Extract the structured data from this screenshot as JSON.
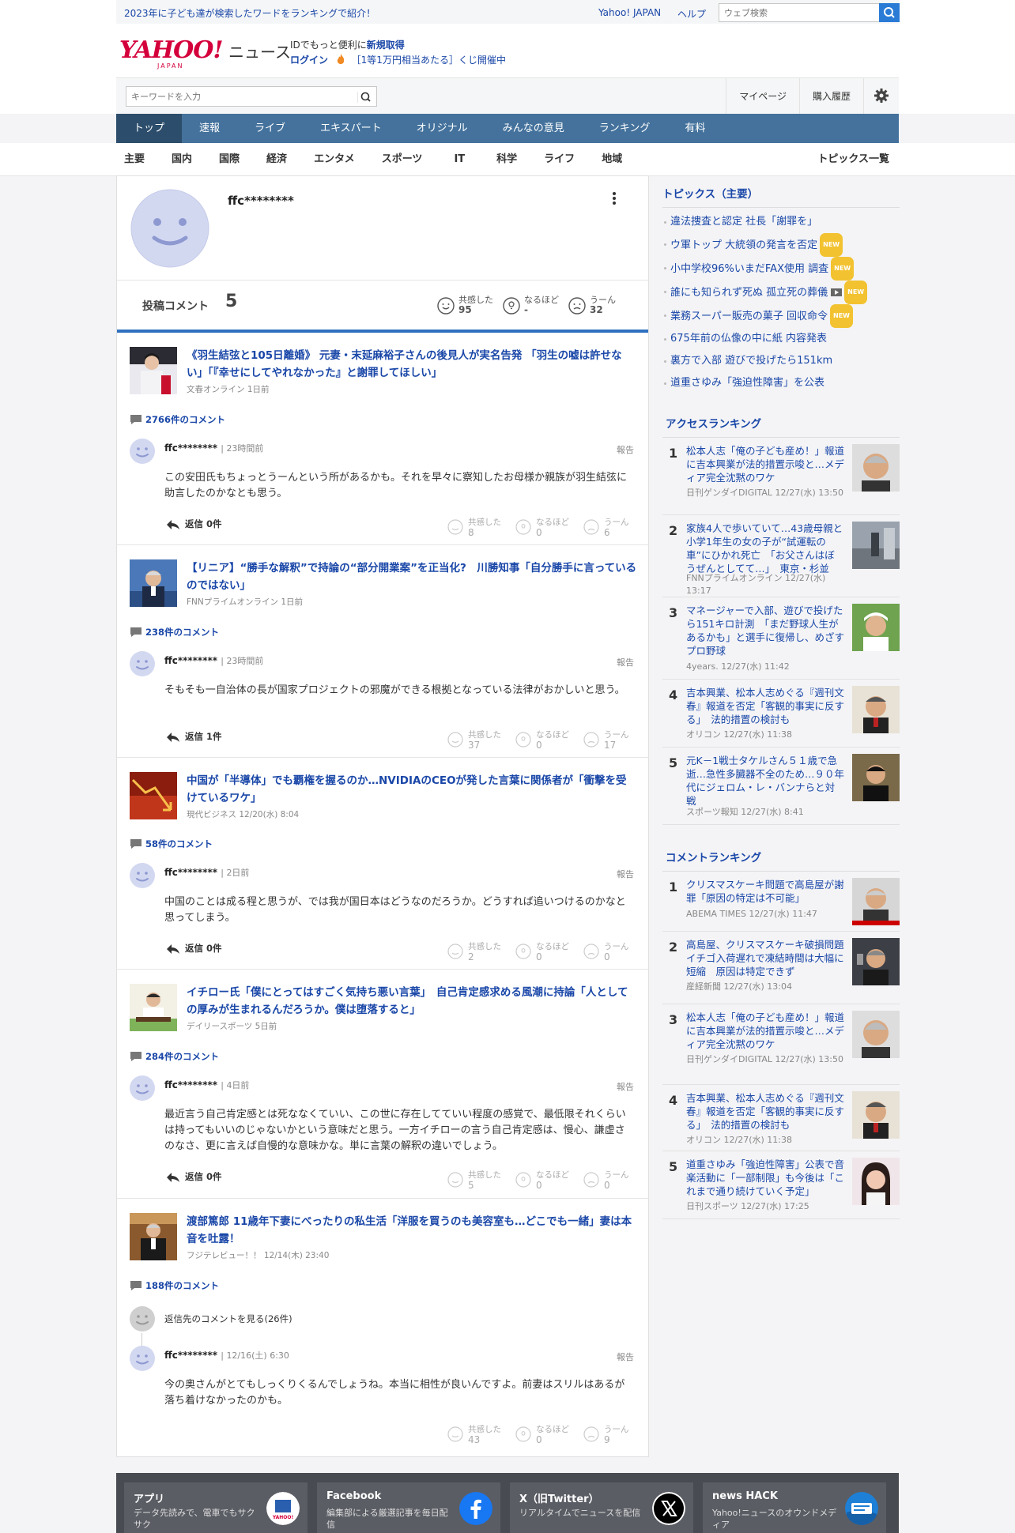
{
  "top": {
    "promo": "2023年に子ども達が検索したワードをランキングで紹介！",
    "yahoo_japan": "Yahoo! JAPAN",
    "help": "ヘルプ",
    "search_placeholder": "ウェブ検索"
  },
  "header": {
    "logo": "YAHOO!",
    "logo_sub": "JAPAN",
    "news": "ニュース",
    "line1_a": "IDでもっと便利に",
    "line1_b": "新規取得",
    "login": "ログイン",
    "lottery": "［1等1万円相当あたる］くじ開催中"
  },
  "searchbar": {
    "placeholder": "キーワードを入力",
    "mypage": "マイページ",
    "purchase": "購入履歴"
  },
  "mainnav": [
    "トップ",
    "速報",
    "ライブ",
    "エキスパート",
    "オリジナル",
    "みんなの意見",
    "ランキング",
    "有料"
  ],
  "subnav": [
    "主要",
    "国内",
    "国際",
    "経済",
    "エンタメ",
    "スポーツ",
    "IT",
    "科学",
    "ライフ",
    "地域"
  ],
  "subnav_topics": "トピックス一覧",
  "profile": {
    "name": "ffc********",
    "comments_label": "投稿コメント",
    "comments_count": "5",
    "reactions": [
      {
        "label": "共感した",
        "value": "95"
      },
      {
        "label": "なるほど",
        "value": "-"
      },
      {
        "label": "うーん",
        "value": "32"
      }
    ]
  },
  "items": [
    {
      "title": "《羽生結弦と105日離婚》 元妻・末延麻裕子さんの後見人が実名告発 「羽生の嘘は許せない」「『幸せにしてやれなかった』と謝罪してほしい」",
      "source": "文春オンライン 1日前",
      "comment_count": "2766件のコメント",
      "user": "ffc********",
      "time": "23時間前",
      "report": "報告",
      "text": "この安田氏もちょっとうーんという所があるかも。それを早々に察知したお母様か親族が羽生結弦に助言したのかなとも思う。",
      "reply": "返信 0件",
      "r1": "8",
      "r2": "0",
      "r3": "6"
    },
    {
      "title": "【リニア】“勝手な解釈”で持論の“部分開業案”を正当化?　川勝知事「自分勝手に言っているのではない」",
      "source": "FNNプライムオンライン 1日前",
      "comment_count": "238件のコメント",
      "user": "ffc********",
      "time": "23時間前",
      "report": "報告",
      "text": "そもそも一自治体の長が国家プロジェクトの邪魔ができる根拠となっている法律がおかしいと思う。",
      "reply": "返信 1件",
      "r1": "37",
      "r2": "0",
      "r3": "17"
    },
    {
      "title": "中国が「半導体」でも覇権を握るのか…NVIDIAのCEOが発した言葉に関係者が「衝撃を受けているワケ」",
      "source": "現代ビジネス 12/20(水) 8:04",
      "comment_count": "58件のコメント",
      "user": "ffc********",
      "time": "2日前",
      "report": "報告",
      "text": "中国のことは成る程と思うが、では我が国日本はどうなのだろうか。どうすれば追いつけるのかなと思ってしまう。",
      "reply": "返信 0件",
      "r1": "2",
      "r2": "0",
      "r3": "0"
    },
    {
      "title": "イチロー氏「僕にとってはすごく気持ち悪い言葉」　自己肯定感求める風潮に持論「人としての厚みが生まれるんだろうか。僕は堕落すると」",
      "source": "デイリースポーツ 5日前",
      "comment_count": "284件のコメント",
      "user": "ffc********",
      "time": "4日前",
      "report": "報告",
      "text": "最近言う自己肯定感とは死ななくていい、この世に存在してていい程度の感覚で、最低限それくらいは持ってもいいのじゃないかという意味だと思う。一方イチローの言う自己肯定感は、慢心、謙虚さのなさ、更に言えば自慢的な意味かな。単に言葉の解釈の違いでしょう。",
      "reply": "返信 0件",
      "r1": "5",
      "r2": "0",
      "r3": "0"
    },
    {
      "title": "渡部篤郎 11歳年下妻にべったりの私生活「洋服を買うのも美容室も…どこでも一緒」妻は本音を吐露！",
      "source": "フジテレビュー！！ 12/14(木) 23:40",
      "comment_count": "188件のコメント",
      "parent_link": "返信先のコメントを見る(26件)",
      "user": "ffc********",
      "time": "12/16(土) 6:30",
      "report": "報告",
      "text": "今の奥さんがとてもしっくりくるんでしょうね。本当に相性が良いんですよ。前妻はスリルはあるが落ち着けなかったのかも。",
      "r1": "43",
      "r2": "0",
      "r3": "9"
    }
  ],
  "reaction_labels": {
    "a": "共感した",
    "b": "なるほど",
    "c": "うーん"
  },
  "topics": {
    "title": "トピックス（主要）",
    "items": [
      "違法捜査と認定 社長「謝罪を」",
      "ウ軍トップ 大統領の発言を否定",
      "小中学校96%いまだFAX使用 調査",
      "誰にも知られず死ぬ 孤立死の葬儀",
      "業務スーパー販売の菓子 回収命令",
      "675年前の仏像の中に紙 内容発表",
      "裏方で入部 遊びで投げたら151km",
      "道重さゆみ「強迫性障害」を公表"
    ],
    "new_badge": "NEW"
  },
  "access_ranking": {
    "title": "アクセスランキング",
    "items": [
      {
        "rank": "1",
        "title": "松本人志「俺の子ども産め！」報道に吉本興業が法的措置示唆と…メディア完全沈黙のワケ",
        "source": "日刊ゲンダイDIGITAL 12/27(水) 13:50"
      },
      {
        "rank": "2",
        "title": "家族4人で歩いていて…43歳母親と小学1年生の女の子が“試運転の車”にひかれ死亡　「お父さんはぼうぜんとしてて…」　東京・杉並",
        "source": "FNNプライムオンライン 12/27(水) 13:17"
      },
      {
        "rank": "3",
        "title": "マネージャーで入部、遊びで投げたら151キロ計測　「まだ野球人生があるかも」と選手に復帰し、めざすプロ野球",
        "source": "4years. 12/27(水) 11:42"
      },
      {
        "rank": "4",
        "title": "吉本興業、松本人志めぐる『週刊文春』報道を否定「客観的事実に反する」　法的措置の検討も",
        "source": "オリコン 12/27(水) 11:38"
      },
      {
        "rank": "5",
        "title": "元K－1戦士タケルさん５１歳で急逝…急性多臓器不全のため…９０年代にジェロム・レ・バンナらと対戦",
        "source": "スポーツ報知 12/27(水) 8:41"
      }
    ]
  },
  "comment_ranking": {
    "title": "コメントランキング",
    "items": [
      {
        "rank": "1",
        "title": "クリスマスケーキ問題で高島屋が謝罪「原因の特定は不可能」",
        "source": "ABEMA TIMES 12/27(水) 11:47"
      },
      {
        "rank": "2",
        "title": "高島屋、クリスマスケーキ破損問題　イチゴ入荷遅れで凍結時間は大幅に短縮　原因は特定できず",
        "source": "産経新聞 12/27(水) 13:04"
      },
      {
        "rank": "3",
        "title": "松本人志「俺の子ども産め！」報道に吉本興業が法的措置示唆と…メディア完全沈黙のワケ",
        "source": "日刊ゲンダイDIGITAL 12/27(水) 13:50"
      },
      {
        "rank": "4",
        "title": "吉本興業、松本人志めぐる『週刊文春』報道を否定「客観的事実に反する」　法的措置の検討も",
        "source": "オリコン 12/27(水) 11:38"
      },
      {
        "rank": "5",
        "title": "道重さゆみ「強迫性障害」公表で音楽活動に「一部制限」も今後は「これまで通り続けていく予定」",
        "source": "日刊スポーツ 12/27(水) 17:25"
      }
    ]
  },
  "footer": [
    {
      "title": "アプリ",
      "desc": "データ先読みで、電車でもサクサク"
    },
    {
      "title": "Facebook",
      "desc": "編集部による厳選記事を毎日配信"
    },
    {
      "title": "X（旧Twitter）",
      "desc": "リアルタイムでニュースを配信"
    },
    {
      "title": "news HACK",
      "desc": "Yahoo!ニュースのオウンドメディア"
    }
  ],
  "colors": {
    "brand_red": "#d4003b",
    "link_blue": "#1a47a8",
    "nav_blue": "#44729c",
    "nav_active": "#2c4d6b",
    "new_badge": "#f2c230"
  }
}
